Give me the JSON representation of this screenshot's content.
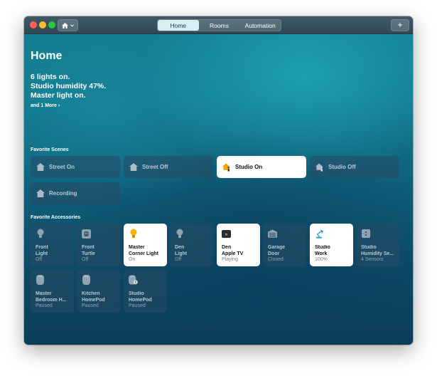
{
  "toolbar": {
    "tabs": [
      {
        "label": "Home",
        "active": true
      },
      {
        "label": "Rooms",
        "active": false
      },
      {
        "label": "Automation",
        "active": false
      }
    ],
    "add_label": "+"
  },
  "home": {
    "title": "Home",
    "summary": [
      "6 lights on.",
      "Studio humidity 47%.",
      "Master light on."
    ],
    "more_label": "and 1 More ›"
  },
  "scenes": {
    "label": "Favorite Scenes",
    "items": [
      {
        "label": "Street On",
        "icon": "house-icon",
        "on": false
      },
      {
        "label": "Street Off",
        "icon": "house-icon",
        "on": false
      },
      {
        "label": "Studio On",
        "icon": "house-person-icon",
        "on": true
      },
      {
        "label": "Studio Off",
        "icon": "house-person-icon",
        "on": false
      },
      {
        "label": "Recording",
        "icon": "house-icon",
        "on": false
      }
    ]
  },
  "accessories": {
    "label": "Favorite Accessories",
    "items": [
      {
        "name": "Front\nLight",
        "status": "Off",
        "icon": "bulb-icon",
        "on": false
      },
      {
        "name": "Front\nTurtle",
        "status": "Off",
        "icon": "outlet-icon",
        "on": false
      },
      {
        "name": "Master\nCorner Light",
        "status": "On",
        "icon": "bulb-icon",
        "on": true
      },
      {
        "name": "Den\nLight",
        "status": "Off",
        "icon": "bulb-icon",
        "on": false
      },
      {
        "name": "Den\nApple TV",
        "status": "Playing",
        "icon": "appletv-icon",
        "on": true
      },
      {
        "name": "Garage\nDoor",
        "status": "Closed",
        "icon": "garage-icon",
        "on": false
      },
      {
        "name": "Studio\nWork",
        "status": "100%",
        "icon": "desk-lamp-icon",
        "on": true
      },
      {
        "name": "Studio\nHumidity Se...",
        "status": "4 Sensors",
        "icon": "sensor-icon",
        "on": false
      },
      {
        "name": "Master\nBedroom H...",
        "status": "Paused",
        "icon": "homepod-icon",
        "on": false
      },
      {
        "name": "Kitchen\nHomePod",
        "status": "Paused",
        "icon": "homepod-icon",
        "on": false
      },
      {
        "name": "Studio\nHomePod",
        "status": "Paused",
        "icon": "homepod-alert-icon",
        "on": false
      }
    ]
  },
  "colors": {
    "accent_on": "#f5b400",
    "tile_on": "#ffffff",
    "window_tint": "#13788e"
  }
}
